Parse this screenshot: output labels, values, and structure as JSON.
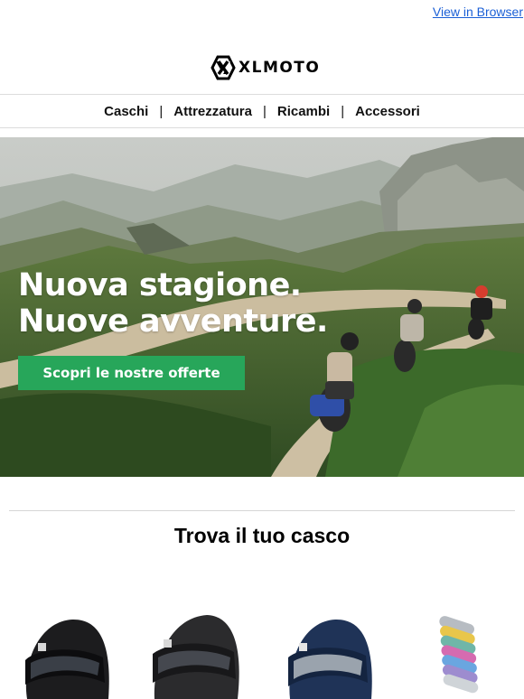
{
  "header": {
    "view_in_browser": "View in Browser",
    "brand": "XLMOTO"
  },
  "nav": {
    "items": [
      "Caschi",
      "Attrezzatura",
      "Ricambi",
      "Accessori"
    ],
    "separator": "|"
  },
  "hero": {
    "title_line1": "Nuova stagione.",
    "title_line2": "Nuove avventure.",
    "cta_label": "Scopri le nostre offerte"
  },
  "section": {
    "title": "Trova il tuo casco"
  },
  "products": [
    {
      "kind": "helmet",
      "color": "#1c1c1e"
    },
    {
      "kind": "helmet",
      "color": "#2b2b2d"
    },
    {
      "kind": "helmet",
      "color": "#1f3357"
    },
    {
      "kind": "visors"
    }
  ],
  "colors": {
    "cta": "#27a65a",
    "link": "#1a5fd6"
  }
}
